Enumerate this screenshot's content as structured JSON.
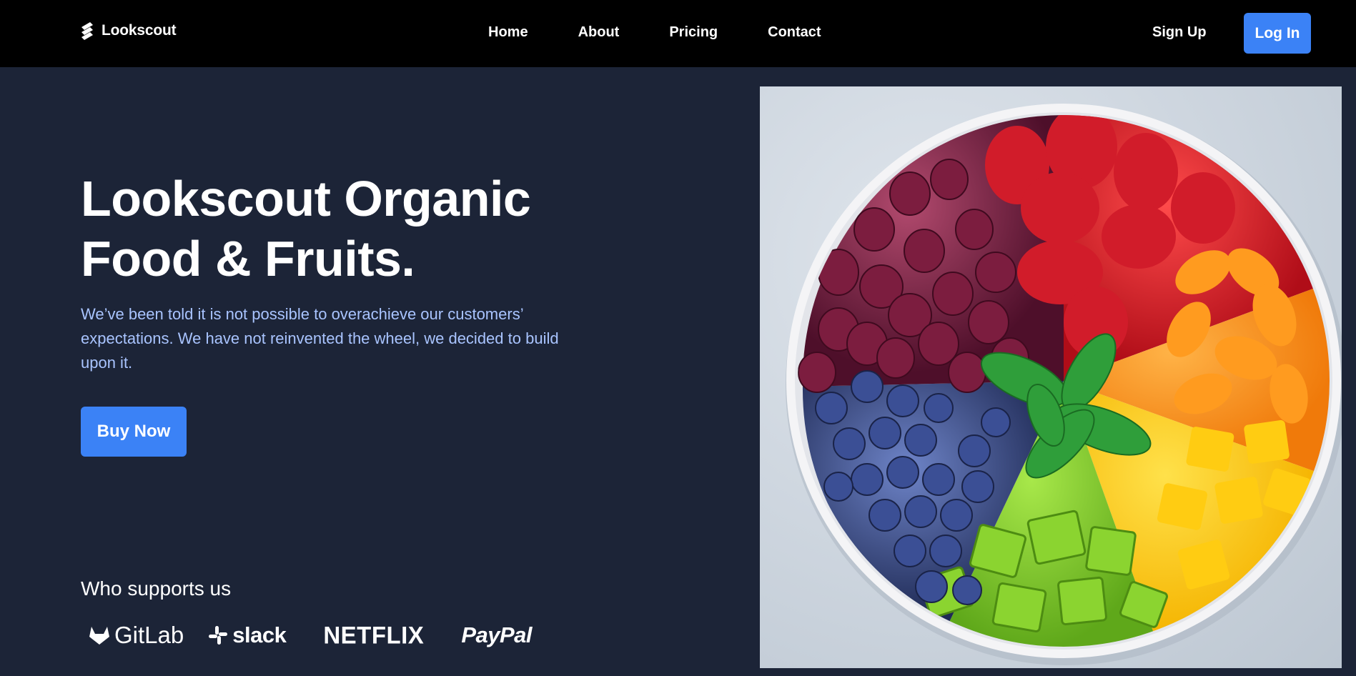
{
  "nav": {
    "brand": "Lookscout",
    "links": [
      "Home",
      "About",
      "Pricing",
      "Contact"
    ],
    "signup": "Sign Up",
    "login": "Log In"
  },
  "hero": {
    "title_line1": "Lookscout Organic",
    "title_line2": "Food & Fruits.",
    "subtitle": "We’ve been told it is not possible to overachieve our customers’ expectations. We have not reinvented the wheel, we decided to build upon it.",
    "cta": "Buy Now",
    "image_icon": "fruit-bowl-photo"
  },
  "supporters": {
    "title": "Who supports us",
    "logos": [
      "GitLab",
      "slack",
      "NETFLIX",
      "PayPal"
    ]
  },
  "colors": {
    "nav_bg": "#000000",
    "page_bg": "#1c2437",
    "accent": "#3b82f6",
    "subtitle_text": "#a9c4ff"
  }
}
